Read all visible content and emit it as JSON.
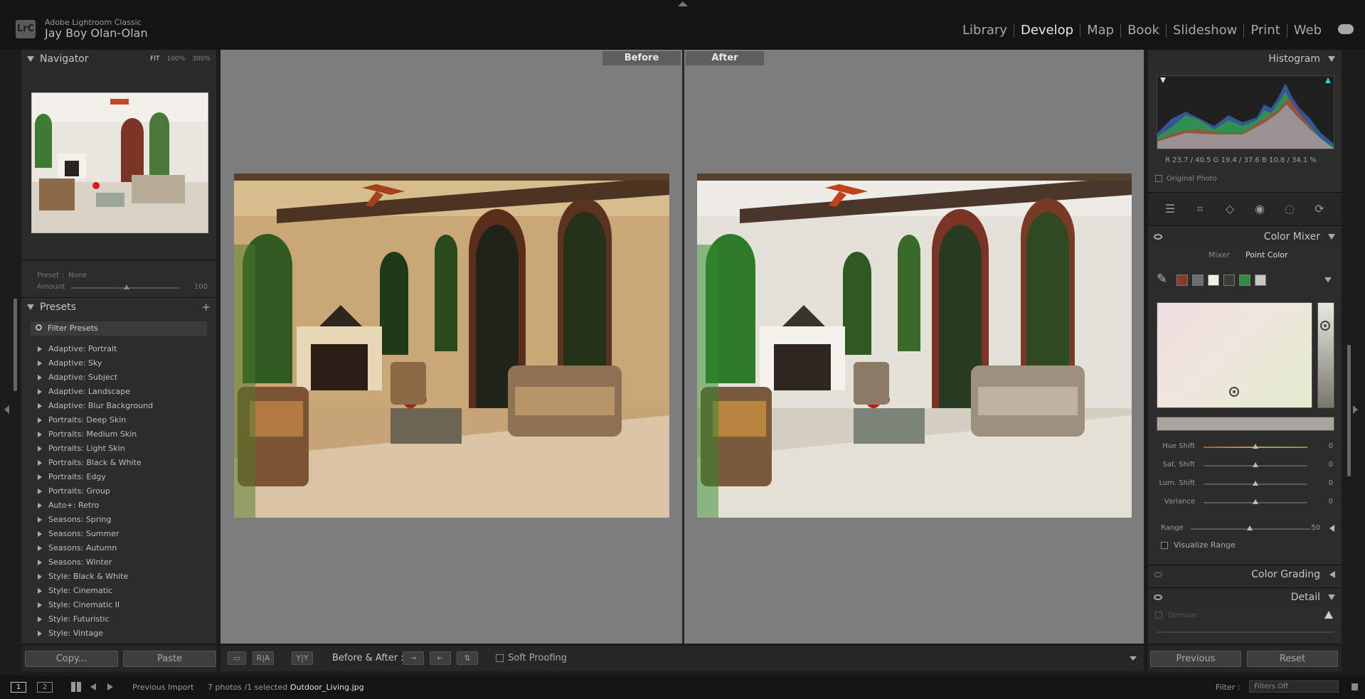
{
  "app": {
    "name": "Adobe Lightroom Classic",
    "logo": "LrC",
    "user": "Jay Boy Olan-Olan"
  },
  "modules": [
    "Library",
    "Develop",
    "Map",
    "Book",
    "Slideshow",
    "Print",
    "Web"
  ],
  "active_module": "Develop",
  "navigator": {
    "title": "Navigator",
    "zoom_fit": "FIT",
    "zoom_100": "100%",
    "zoom_300": "300%"
  },
  "preset_amount": {
    "preset_label": "Preset :",
    "preset_value": "None",
    "amount_label": "Amount",
    "amount_value": "100",
    "amount_level": 0.5
  },
  "presets": {
    "title": "Presets",
    "filter_placeholder": "Filter Presets",
    "items": [
      "Adaptive: Portrait",
      "Adaptive: Sky",
      "Adaptive: Subject",
      "Adaptive: Landscape",
      "Adaptive: Blur Background",
      "Portraits: Deep Skin",
      "Portraits: Medium Skin",
      "Portraits: Light Skin",
      "Portraits: Black & White",
      "Portraits: Edgy",
      "Portraits: Group",
      "Auto+: Retro",
      "Seasons: Spring",
      "Seasons: Summer",
      "Seasons: Autumn",
      "Seasons: Winter",
      "Style: Black & White",
      "Style: Cinematic",
      "Style: Cinematic II",
      "Style: Futuristic",
      "Style: Vintage"
    ]
  },
  "left_buttons": {
    "copy": "Copy...",
    "paste": "Paste"
  },
  "view": {
    "before": "Before",
    "after": "After"
  },
  "toolbar": {
    "view_yy": "Y|Y",
    "view_ab": "R|A",
    "before_after_label": "Before & After :",
    "soft_proofing": "Soft Proofing"
  },
  "histogram": {
    "title": "Histogram",
    "rgb": "R  23.7 / 40.5   G  19.4 / 37.6   B  10.8 /  34.1  %",
    "original_photo": "Original Photo"
  },
  "color_mixer": {
    "title": "Color Mixer",
    "tab_mixer": "Mixer",
    "tab_point": "Point Color",
    "swatches": [
      "#8b3a2a",
      "#6d6d6d",
      "#f3f0e0",
      "#3c3a35",
      "#2f8f3f",
      "#c9c6bd"
    ],
    "sliders": [
      {
        "label": "Hue Shift",
        "value": "0"
      },
      {
        "label": "Sat. Shift",
        "value": "0"
      },
      {
        "label": "Lum. Shift",
        "value": "0"
      },
      {
        "label": "Variance",
        "value": "0"
      }
    ],
    "range_label": "Range",
    "range_value": "50",
    "visualize": "Visualize Range"
  },
  "color_grading": {
    "title": "Color Grading"
  },
  "detail": {
    "title": "Detail",
    "denoise": "Denoise"
  },
  "right_buttons": {
    "previous": "Previous",
    "reset": "Reset"
  },
  "filmstrip": {
    "page1": "1",
    "page2": "2",
    "source": "Previous Import",
    "count": "7 photos /1 selected /",
    "filename": "Outdoor_Living.jpg",
    "filter_label": "Filter :",
    "filter_value": "Filters Off"
  }
}
